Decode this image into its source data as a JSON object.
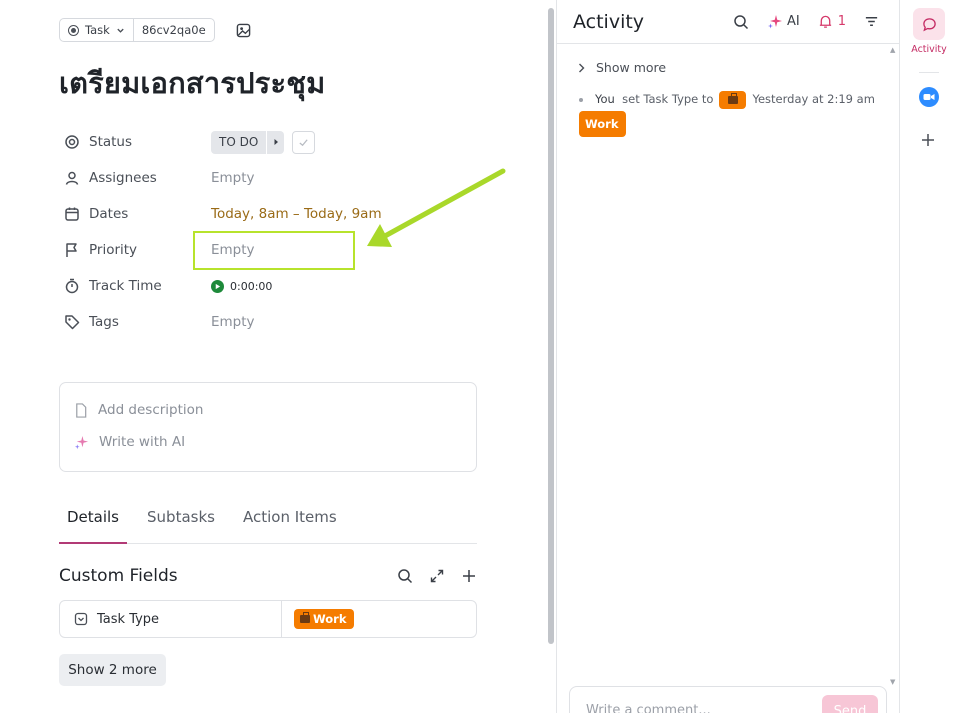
{
  "task": {
    "type_label": "Task",
    "task_id": "86cv2qa0e",
    "title": "เตรียมเอกสารประชุม"
  },
  "fields": {
    "status": {
      "label": "Status",
      "value": "TO DO"
    },
    "assignees": {
      "label": "Assignees",
      "value": "Empty"
    },
    "dates": {
      "label": "Dates",
      "value": "Today, 8am – Today, 9am"
    },
    "priority": {
      "label": "Priority",
      "value": "Empty"
    },
    "track_time": {
      "label": "Track Time",
      "value": "0:00:00"
    },
    "tags": {
      "label": "Tags",
      "value": "Empty"
    }
  },
  "description": {
    "add_label": "Add description",
    "ai_label": "Write with AI"
  },
  "tabs": [
    {
      "label": "Details",
      "active": true
    },
    {
      "label": "Subtasks",
      "active": false
    },
    {
      "label": "Action Items",
      "active": false
    }
  ],
  "custom_fields": {
    "title": "Custom Fields",
    "rows": [
      {
        "name": "Task Type",
        "value": "Work"
      }
    ],
    "show_more_label": "Show 2 more"
  },
  "activity": {
    "title": "Activity",
    "ai_label": "AI",
    "notification_count": "1",
    "show_more_label": "Show more",
    "items": [
      {
        "actor": "You",
        "action": "set Task Type to",
        "timestamp": "Yesterday at 2:19 am",
        "value": "Work"
      }
    ],
    "comment_placeholder": "Write a comment...",
    "send_label": "Send"
  },
  "rail": {
    "active_label": "Activity"
  },
  "colors": {
    "accent": "#c42b63",
    "work_badge": "#f57c00",
    "highlight": "#b7e32c",
    "dates_text": "#9a6b17",
    "timer_green": "#1e8a3a"
  }
}
